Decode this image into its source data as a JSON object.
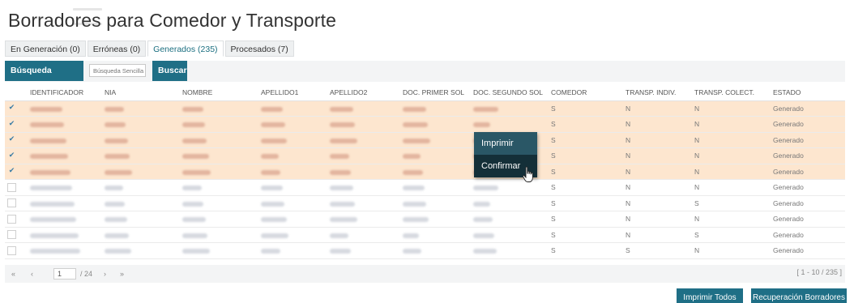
{
  "title": "Borradores para Comedor y Transporte",
  "tabs": [
    {
      "label": "En Generación (0)"
    },
    {
      "label": "Erróneas (0)"
    },
    {
      "label": "Generados (235)"
    },
    {
      "label": "Procesados (7)"
    }
  ],
  "toolbar": {
    "advanced_label": "Búsqueda avanzada",
    "search_placeholder": "Búsqueda Sencilla",
    "search_label": "Buscar"
  },
  "table": {
    "headers": [
      "IDENTIFICADOR",
      "NIA",
      "NOMBRE",
      "APELLIDO1",
      "APELLIDO2",
      "DOC. PRIMER SOL",
      "DOC. SEGUNDO SOL",
      "COMEDOR",
      "TRANSP. INDIV.",
      "TRANSP. COLECT.",
      "ESTADO"
    ],
    "rows": [
      {
        "selected": true,
        "check": "✔",
        "comedor": "S",
        "indiv": "N",
        "colect": "N",
        "estado": "Generado"
      },
      {
        "selected": true,
        "check": "✔",
        "comedor": "S",
        "indiv": "N",
        "colect": "N",
        "estado": "Generado"
      },
      {
        "selected": true,
        "check": "✔",
        "comedor": "S",
        "indiv": "N",
        "colect": "N",
        "estado": "Generado"
      },
      {
        "selected": true,
        "check": "✔",
        "comedor": "S",
        "indiv": "N",
        "colect": "N",
        "estado": "Generado"
      },
      {
        "selected": true,
        "check": "✔",
        "comedor": "S",
        "indiv": "N",
        "colect": "N",
        "estado": "Generado"
      },
      {
        "selected": false,
        "check": "",
        "comedor": "S",
        "indiv": "N",
        "colect": "N",
        "estado": "Generado"
      },
      {
        "selected": false,
        "check": "",
        "comedor": "S",
        "indiv": "N",
        "colect": "S",
        "estado": "Generado"
      },
      {
        "selected": false,
        "check": "",
        "comedor": "S",
        "indiv": "N",
        "colect": "N",
        "estado": "Generado"
      },
      {
        "selected": false,
        "check": "",
        "comedor": "S",
        "indiv": "N",
        "colect": "S",
        "estado": "Generado"
      },
      {
        "selected": false,
        "check": "",
        "comedor": "S",
        "indiv": "S",
        "colect": "N",
        "estado": "Generado"
      }
    ]
  },
  "context_menu": {
    "items": [
      "Imprimir",
      "Confirmar"
    ]
  },
  "pager": {
    "first": "«",
    "prev": "‹",
    "page": "1",
    "total_pages": "/ 24",
    "next": "›",
    "last": "»",
    "range": "[ 1 - 10 / 235 ]"
  },
  "footer": {
    "print_all_label": "Imprimir Todos",
    "recover_label": "Recuperación Borradores"
  },
  "colors": {
    "accent": "#1f6f86",
    "selected_row": "#fde6cf",
    "context_menu": "#2a5766"
  }
}
